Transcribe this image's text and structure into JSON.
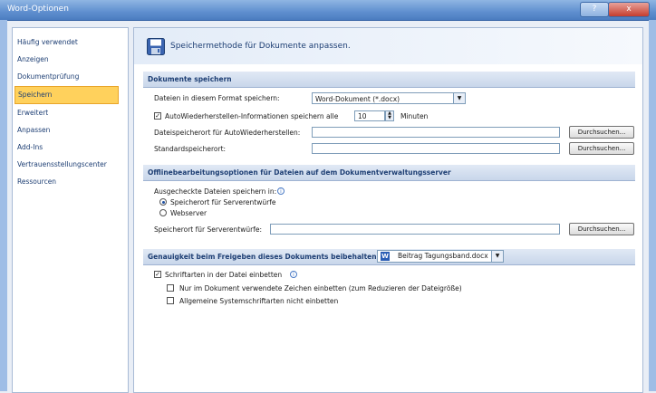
{
  "window": {
    "title": "Word-Optionen",
    "help_label": "?",
    "close_label": "x"
  },
  "sidebar": {
    "items": [
      {
        "label": "Häufig verwendet"
      },
      {
        "label": "Anzeigen"
      },
      {
        "label": "Dokumentprüfung"
      },
      {
        "label": "Speichern"
      },
      {
        "label": "Erweitert"
      },
      {
        "label": "Anpassen"
      },
      {
        "label": "Add-Ins"
      },
      {
        "label": "Vertrauensstellungscenter"
      },
      {
        "label": "Ressourcen"
      }
    ],
    "active": "Speichern"
  },
  "header": {
    "title": "Speichermethode für Dokumente anpassen.",
    "icon": "save-icon"
  },
  "sections": {
    "save_docs": {
      "title": "Dokumente speichern",
      "format_label": "Dateien in diesem Format speichern:",
      "format_value": "Word-Dokument (*.docx)",
      "autorecover_label": "AutoWiederherstellen-Informationen speichern alle",
      "autorecover_checked": true,
      "autorecover_minutes": "10",
      "minutes_label": "Minuten",
      "autorecover_path_label": "Dateispeicherort für AutoWiederherstellen:",
      "default_path_label": "Standardspeicherort:",
      "browse_label": "Durchsuchen..."
    },
    "offline": {
      "title": "Offlinebearbeitungsoptionen für Dateien auf dem Dokumentverwaltungsserver",
      "checked_out_label": "Ausgecheckte Dateien speichern in:",
      "radio_drafts": "Speicherort für Serverentwürfe",
      "radio_webserver": "Webserver",
      "selected": "Speicherort für Serverentwürfe",
      "drafts_path_label": "Speicherort für Serverentwürfe:",
      "browse_label": "Durchsuchen..."
    },
    "fidelity": {
      "title": "Genauigkeit beim Freigeben dieses Dokuments beibehalten:",
      "doc_value": "Beitrag Tagungsband.docx",
      "embed_fonts_label": "Schriftarten in der Datei einbetten",
      "embed_fonts_checked": true,
      "only_used_label": "Nur im Dokument verwendete Zeichen einbetten (zum Reduzieren der Dateigröße)",
      "only_used_checked": false,
      "no_system_label": "Allgemeine Systemschriftarten nicht einbetten",
      "no_system_checked": false
    }
  }
}
